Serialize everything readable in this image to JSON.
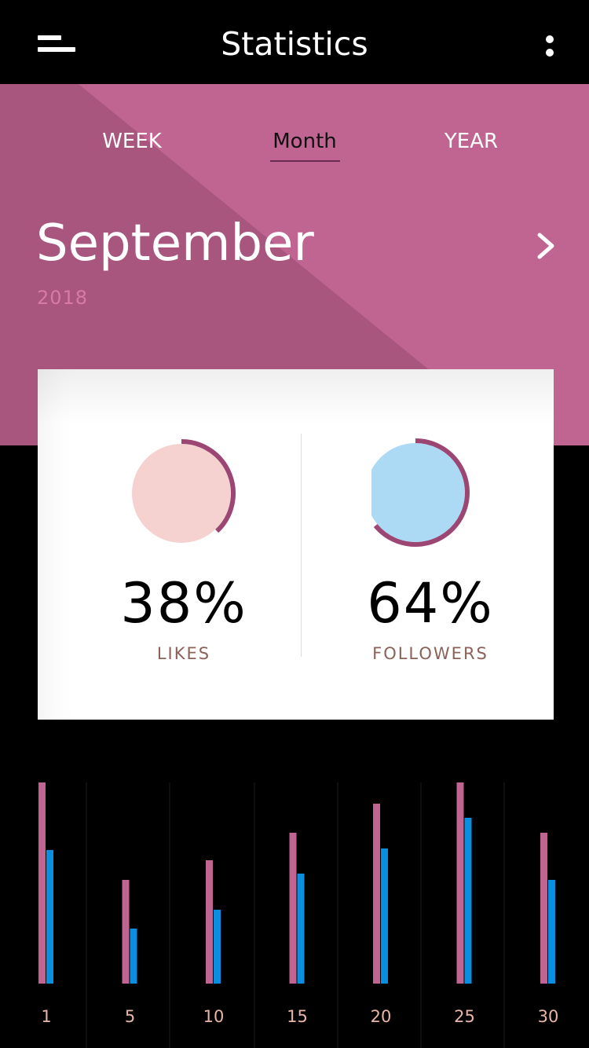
{
  "header": {
    "title": "Statistics"
  },
  "tabs": [
    {
      "label": "WEEK"
    },
    {
      "label": "Month"
    },
    {
      "label": "YEAR"
    }
  ],
  "selected_tab": "Month",
  "period": {
    "month": "September",
    "year": "2018"
  },
  "stats": {
    "likes": {
      "percent_text": "38%",
      "label": "LIKES",
      "value": 0.38
    },
    "followers": {
      "percent_text": "64%",
      "label": "FOLLOWERS",
      "value": 0.64
    }
  },
  "colors": {
    "hero": "#c06591",
    "hero_dark": "#a9567e",
    "likes_fill": "#f5d2d0",
    "followers_fill": "#acdaf5",
    "ring": "#9c4674",
    "series_likes": "#c06591",
    "series_followers": "#0a8ee0"
  },
  "chart_data": {
    "type": "bar",
    "categories": [
      "1",
      "5",
      "10",
      "15",
      "20",
      "25",
      "30"
    ],
    "series": [
      {
        "values": [
          256,
          132,
          157,
          192,
          229,
          256,
          192
        ]
      },
      {
        "values": [
          170,
          70,
          94,
          140,
          172,
          211,
          132
        ]
      }
    ],
    "xlabel": "",
    "ylabel": "",
    "ylim": [
      0,
      256
    ],
    "grid": true
  }
}
